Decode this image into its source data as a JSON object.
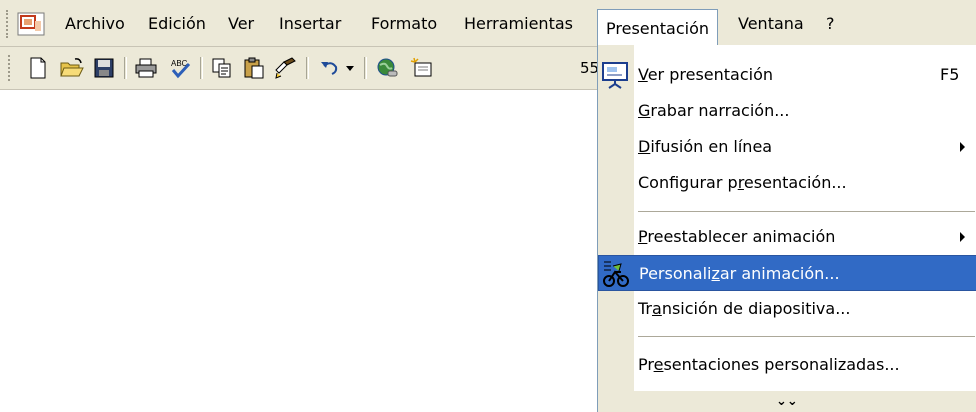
{
  "menubar": {
    "items": [
      {
        "label": "Archivo"
      },
      {
        "label": "Edición"
      },
      {
        "label": "Ver"
      },
      {
        "label": "Insertar"
      },
      {
        "label": "Formato"
      },
      {
        "label": "Herramientas"
      },
      {
        "label": "Presentación"
      },
      {
        "label": "Ventana"
      },
      {
        "label": "?"
      }
    ]
  },
  "toolbar": {
    "zoom_partial": "55"
  },
  "dropdown": {
    "items": [
      {
        "label": "Ver presentación",
        "shortcut": "F5",
        "icon": "slideshow-icon"
      },
      {
        "label": "Grabar narración..."
      },
      {
        "label": "Difusión en línea",
        "submenu": true
      },
      {
        "label": "Configurar presentación..."
      },
      {
        "label": "Preestablecer animación",
        "submenu": true
      },
      {
        "label": "Personalizar animación...",
        "icon": "custom-animation-icon",
        "highlighted": true
      },
      {
        "label": "Transición de diapositiva..."
      },
      {
        "label": "Presentaciones personalizadas..."
      }
    ],
    "expand_glyph": "¥"
  },
  "colors": {
    "menu_bg": "#ece9d8",
    "highlight": "#316ac5"
  }
}
